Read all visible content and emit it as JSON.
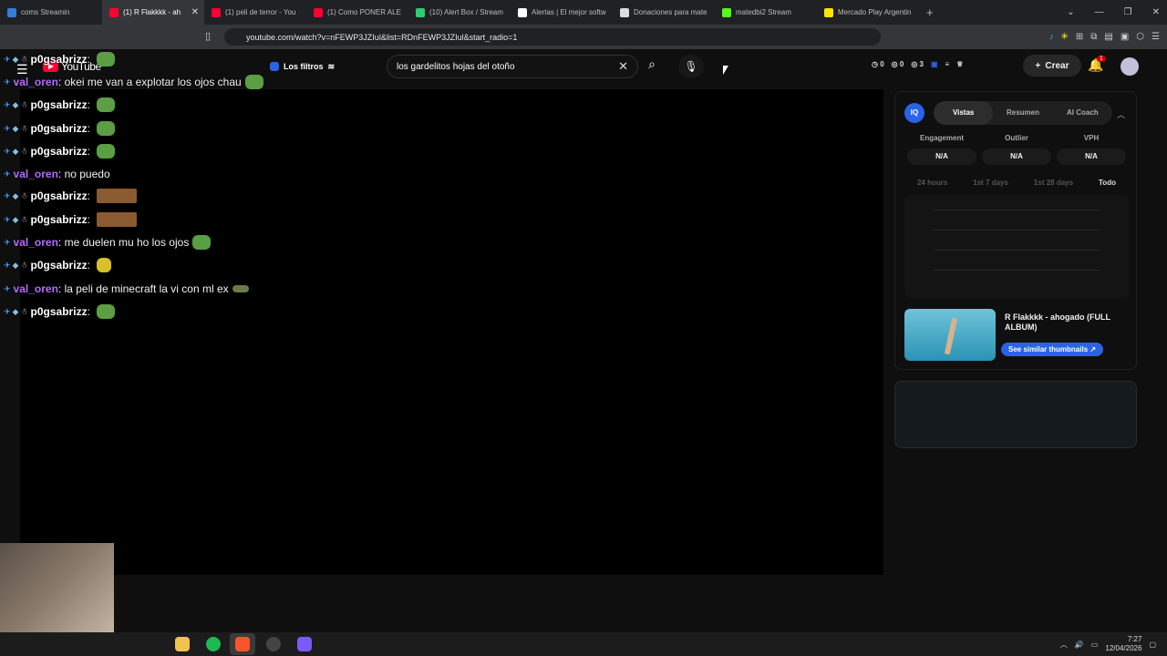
{
  "browser": {
    "tabs": [
      {
        "label": "coms Streamin",
        "color": "#3a7bd5",
        "active": false
      },
      {
        "label": "(1) R Flakkkk - ah",
        "color": "#ff0033",
        "active": true
      },
      {
        "label": "(1) peli de terror - You",
        "color": "#ff0033",
        "active": false
      },
      {
        "label": "(1) Como PONER ALE",
        "color": "#ff0033",
        "active": false
      },
      {
        "label": "(10) Alert Box / Stream",
        "color": "#2ecc71",
        "active": false
      },
      {
        "label": "Alertas | El mejor softw",
        "color": "#ffffff",
        "active": false
      },
      {
        "label": "Donaciones para mate",
        "color": "#dddddd",
        "active": false
      },
      {
        "label": "matedbi2 Stream",
        "color": "#53fc18",
        "active": false
      },
      {
        "label": "Mercado Play Argentin",
        "color": "#ffe600",
        "active": false
      }
    ],
    "url": "youtube.com/watch?v=nFEWP3JZIul&list=RDnFEWP3JZIul&start_radio=1"
  },
  "youtube": {
    "logo": "YouTube",
    "filters_label": "Los filtros",
    "search_value": "los gardelitos hojas del otoño",
    "stats": [
      "0",
      "0",
      "3"
    ],
    "create_label": "Crear",
    "notif_count": "1"
  },
  "chat": [
    {
      "user": "p0gsabrizz",
      "color": "#ffffff",
      "text": "",
      "emote": "pepe",
      "badges": true
    },
    {
      "user": "val_oren",
      "color": "#b36bff",
      "text": "okei me van a explotar los ojos chau",
      "emote": "pepe",
      "badges": false
    },
    {
      "user": "p0gsabrizz",
      "color": "#ffffff",
      "text": "",
      "emote": "pepe",
      "badges": true
    },
    {
      "user": "p0gsabrizz",
      "color": "#ffffff",
      "text": "",
      "emote": "pepe",
      "badges": true
    },
    {
      "user": "p0gsabrizz",
      "color": "#ffffff",
      "text": "",
      "emote": "pepe",
      "badges": true
    },
    {
      "user": "val_oren",
      "color": "#b36bff",
      "text": "no puedo",
      "emote": "",
      "badges": false
    },
    {
      "user": "p0gsabrizz",
      "color": "#ffffff",
      "text": "",
      "emote": "duo",
      "badges": true
    },
    {
      "user": "p0gsabrizz",
      "color": "#ffffff",
      "text": "",
      "emote": "duo",
      "badges": true
    },
    {
      "user": "val_oren",
      "color": "#b36bff",
      "text": "me duelen mu ho los ojos",
      "emote": "pepe",
      "badges": false
    },
    {
      "user": "p0gsabrizz",
      "color": "#ffffff",
      "text": "",
      "emote": "yellow",
      "badges": true
    },
    {
      "user": "val_oren",
      "color": "#b36bff",
      "text": "la peli de minecraft la vi con ml ex",
      "emote": "turtle",
      "badges": false
    },
    {
      "user": "p0gsabrizz",
      "color": "#ffffff",
      "text": "",
      "emote": "pepe",
      "badges": true
    }
  ],
  "vidiq": {
    "badge": "IQ",
    "tabs": [
      "Vistas",
      "Resumen",
      "AI Coach"
    ],
    "metrics": [
      {
        "label": "Engagement",
        "value": "N/A"
      },
      {
        "label": "Outlier",
        "value": "N/A"
      },
      {
        "label": "VPH",
        "value": "N/A"
      }
    ],
    "ranges": [
      "24 hours",
      "1st 7 days",
      "1st 28 days",
      "Todo"
    ],
    "video_title": "R Flakkkk - ahogado (FULL ALBUM)",
    "similar_label": "See similar thumbnails ↗"
  },
  "taskbar": {
    "time": "7:27",
    "date": "12/04/2026"
  }
}
